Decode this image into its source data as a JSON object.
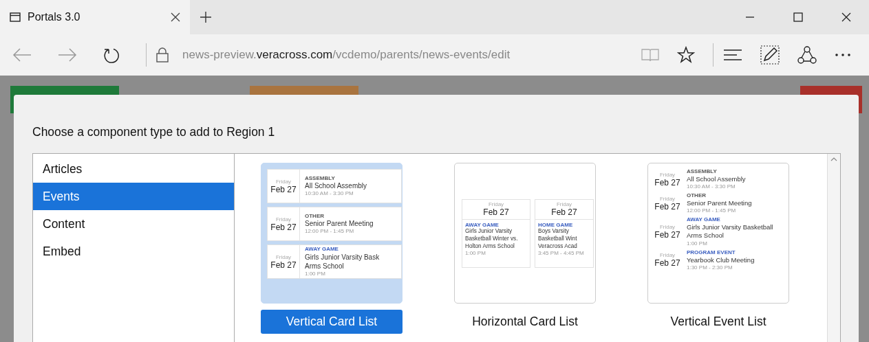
{
  "browser": {
    "tab_title": "Portals 3.0",
    "url": {
      "prefix": "news-preview.",
      "domain": "veracross.com",
      "path": "/vcdemo/parents/news-events/edit"
    }
  },
  "dialog": {
    "title": "Choose a component type to add to Region 1",
    "categories": [
      {
        "label": "Articles",
        "selected": false
      },
      {
        "label": "Events",
        "selected": true
      },
      {
        "label": "Content",
        "selected": false
      },
      {
        "label": "Embed",
        "selected": false
      }
    ],
    "components": [
      {
        "kind": "vertical-card",
        "label": "Vertical Card List",
        "selected": true,
        "events": [
          {
            "day": "Friday",
            "date": "Feb 27",
            "category": "ASSEMBLY",
            "color": "#555555",
            "lines": [
              "All School Assembly"
            ],
            "time": "10:30 AM - 3:30 PM"
          },
          {
            "day": "Friday",
            "date": "Feb 27",
            "category": "OTHER",
            "color": "#555555",
            "lines": [
              "Senior Parent Meeting"
            ],
            "time": "12:00 PM - 1:45 PM"
          },
          {
            "day": "Friday",
            "date": "Feb 27",
            "category": "AWAY GAME",
            "color": "#3b5fc0",
            "lines": [
              "Girls Junior Varsity Bask",
              "Arms School"
            ],
            "time": "1:00 PM"
          }
        ]
      },
      {
        "kind": "horizontal-card",
        "label": "Horizontal Card List",
        "selected": false,
        "events": [
          {
            "day": "Friday",
            "date": "Feb 27",
            "category": "AWAY GAME",
            "color": "#3b5fc0",
            "lines": [
              "Girls Junior Varsity",
              "Basketball Winter vs.",
              "Holton Arms School"
            ],
            "time": "1:00 PM"
          },
          {
            "day": "Friday",
            "date": "Feb 27",
            "category": "HOME GAME",
            "color": "#3b5fc0",
            "lines": [
              "Boys Varsity",
              "Basketball Wint",
              "Veracross Acad"
            ],
            "time": "3:45 PM - 4:45 PM"
          }
        ]
      },
      {
        "kind": "event-list",
        "label": "Vertical Event List",
        "selected": false,
        "events": [
          {
            "day": "Friday",
            "date": "Feb 27",
            "category": "ASSEMBLY",
            "color": "#555555",
            "lines": [
              "All School Assembly"
            ],
            "time": "10:30 AM - 3:30 PM"
          },
          {
            "day": "Friday",
            "date": "Feb 27",
            "category": "OTHER",
            "color": "#555555",
            "lines": [
              "Senior Parent Meeting"
            ],
            "time": "12:00 PM - 1:45 PM"
          },
          {
            "day": "Friday",
            "date": "Feb 27",
            "category": "AWAY GAME",
            "color": "#3b5fc0",
            "lines": [
              "Girls Junior Varsity Basketball",
              "Arms School"
            ],
            "time": "1:00 PM"
          },
          {
            "day": "Friday",
            "date": "Feb 27",
            "category": "PROGRAM EVENT",
            "color": "#3b5fc0",
            "lines": [
              "Yearbook Club Meeting"
            ],
            "time": "1:30 PM - 2:30 PM"
          }
        ]
      }
    ]
  }
}
